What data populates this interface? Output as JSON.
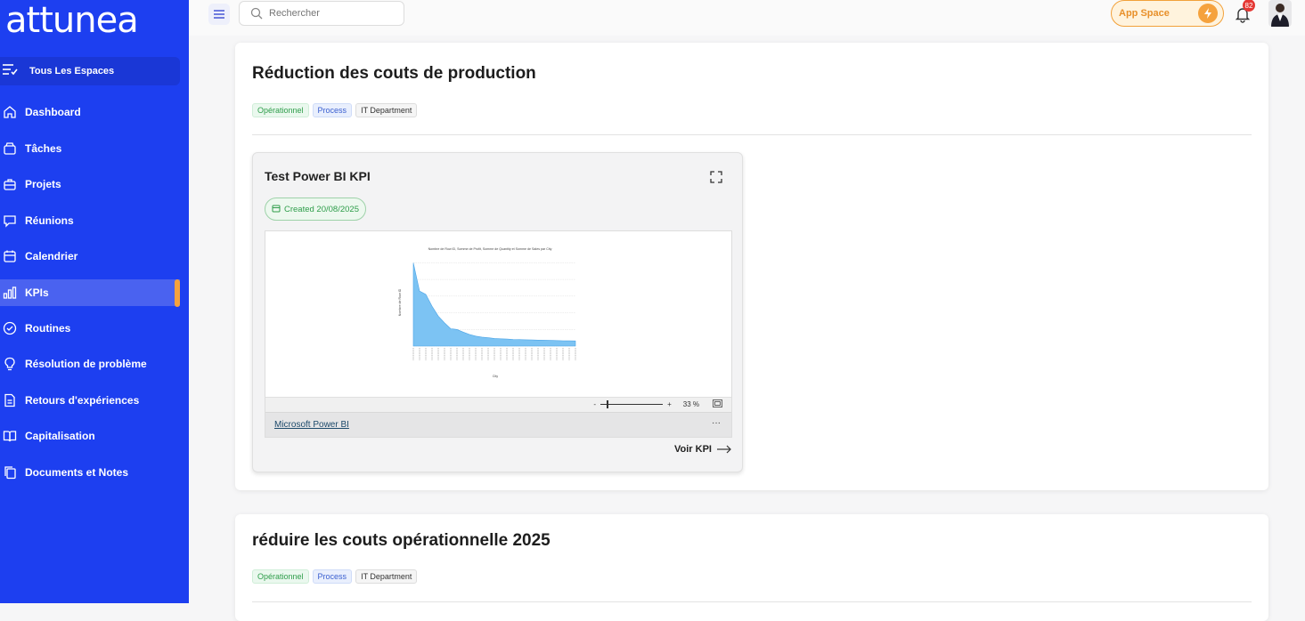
{
  "brand": {
    "logo_text": "attunea"
  },
  "sidebar": {
    "all_spaces": {
      "icon": "list-check-icon",
      "label": "Tous Les Espaces"
    },
    "items": [
      {
        "icon": "home-icon",
        "label": "Dashboard"
      },
      {
        "icon": "tray-icon",
        "label": "Tâches"
      },
      {
        "icon": "briefcase-icon",
        "label": "Projets"
      },
      {
        "icon": "chat-icon",
        "label": "Réunions"
      },
      {
        "icon": "calendar-icon",
        "label": "Calendrier"
      },
      {
        "icon": "bar-chart-icon",
        "label": "KPIs",
        "active": true
      },
      {
        "icon": "check-circle-icon",
        "label": "Routines"
      },
      {
        "icon": "lightbulb-icon",
        "label": "Résolution de problème"
      },
      {
        "icon": "document-icon",
        "label": "Retours d'expériences"
      },
      {
        "icon": "book-icon",
        "label": "Capitalisation"
      },
      {
        "icon": "copy-icon",
        "label": "Documents et Notes"
      }
    ],
    "accent_color": "#f5a23d",
    "background_color": "#1d3ff0"
  },
  "topbar": {
    "search_placeholder": "Rechercher",
    "app_space_label": "App Space",
    "notification_count": "82"
  },
  "cards": [
    {
      "title": "Réduction des couts de production",
      "tags": [
        "Opérationnel",
        "Process",
        "IT Department"
      ],
      "kpi": {
        "title": "Test Power BI KPI",
        "created": "Created 20/08/2025",
        "zoom_level": "33 %",
        "zoom_minus": "-",
        "zoom_plus": "+",
        "provider_link": "Microsoft Power BI",
        "more": "···",
        "action": "Voir KPI"
      }
    },
    {
      "title": "réduire les couts opérationnelle 2025",
      "tags": [
        "Opérationnel",
        "Process",
        "IT Department"
      ]
    }
  ],
  "chart_data": {
    "type": "area",
    "title": "Nombre de Row ID, Somme de Profit, Somme de Quantity et Somme de Sales par City",
    "xlabel": "City",
    "ylabel": "Nombre de Row ID",
    "series": [
      {
        "values": [
          2500,
          1650,
          1550,
          1200,
          900,
          700,
          520,
          500,
          420,
          350,
          300,
          270,
          250,
          230,
          220,
          210,
          200,
          195,
          190,
          185,
          180,
          175,
          170,
          165,
          160,
          158,
          155
        ]
      }
    ],
    "ylim": [
      0,
      2750
    ],
    "grid": true,
    "color": "#7cc3f3"
  }
}
